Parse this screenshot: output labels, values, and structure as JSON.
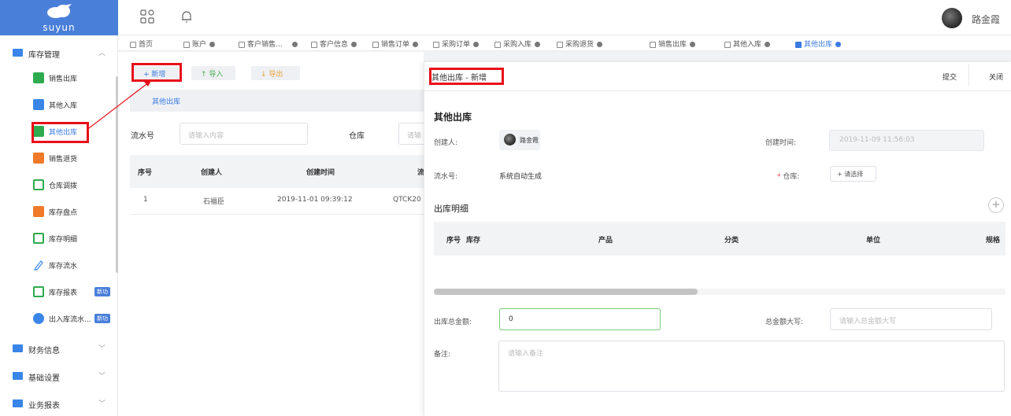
{
  "brand": {
    "name": "suyun"
  },
  "topbar": {
    "username": "路金霞"
  },
  "sidebar": {
    "group_inventory": "库存管理",
    "items": [
      {
        "label": "销售出库",
        "icon": "export-icon",
        "color": "#2eab4f"
      },
      {
        "label": "其他入库",
        "icon": "import-icon",
        "color": "#3a86e8"
      },
      {
        "label": "其他出库",
        "icon": "document-icon",
        "color": "#2eab4f"
      },
      {
        "label": "销售退货",
        "icon": "return-icon",
        "color": "#f07a2a"
      },
      {
        "label": "仓库调拨",
        "icon": "transfer-icon",
        "color": "#2eab4f"
      },
      {
        "label": "库存盘点",
        "icon": "stocktake-icon",
        "color": "#f07a2a"
      },
      {
        "label": "库存明细",
        "icon": "detail-icon",
        "color": "#2eab4f"
      },
      {
        "label": "库存流水",
        "icon": "pen-icon",
        "color": "#3a86e8"
      },
      {
        "label": "库存报表",
        "icon": "report-icon",
        "color": "#2eab4f",
        "badge": "新功"
      },
      {
        "label": "出入库流水...",
        "icon": "user-icon",
        "color": "#3a86e8",
        "badge": "新功"
      }
    ],
    "group_finance": "财务信息",
    "group_basic": "基础设置",
    "group_reports": "业务报表"
  },
  "tabs": [
    {
      "label": "首页"
    },
    {
      "label": "账户"
    },
    {
      "label": "客户销售..."
    },
    {
      "label": "客户信息"
    },
    {
      "label": "销售订单"
    },
    {
      "label": "采购订单"
    },
    {
      "label": "采购入库"
    },
    {
      "label": "采购退货"
    },
    {
      "label": "销售出库"
    },
    {
      "label": "其他入库"
    },
    {
      "label": "其他出库"
    }
  ],
  "toolbar": {
    "new": "+ 新增",
    "import": "↑ 导入",
    "export": "↓ 导出"
  },
  "list": {
    "title": "其他出库",
    "filter_serial_label": "流水号",
    "filter_serial_placeholder": "请输入内容",
    "filter_warehouse_label": "仓库",
    "filter_warehouse_placeholder": "请输",
    "columns": [
      "序号",
      "创建人",
      "创建时间",
      "流"
    ],
    "rows": [
      {
        "no": "1",
        "creator": "石福臣",
        "time": "2019-11-01 09:39:12",
        "serial": "QTCK20"
      }
    ]
  },
  "panel": {
    "title": "其他出库 - 新增",
    "submit": "提交",
    "close": "关闭",
    "section": "其他出库",
    "creator_label": "创建人:",
    "creator_name": "路金霞",
    "created_time_label": "创建时间:",
    "created_time_value": "2019-11-09 11:56:03",
    "serial_label": "流水号:",
    "serial_value": "系统自动生成",
    "warehouse_label_req": "*",
    "warehouse_label": "仓库:",
    "warehouse_choose": "+ 请选择",
    "detail_title": "出库明细",
    "detail_columns": [
      "序号",
      "库存",
      "产品",
      "分类",
      "单位",
      "规格"
    ],
    "total_label": "出库总金额:",
    "total_value": "0",
    "capital_label": "总金额大写:",
    "capital_placeholder": "请输入总金额大写",
    "note_label": "备注:",
    "note_placeholder": "请输入备注"
  }
}
